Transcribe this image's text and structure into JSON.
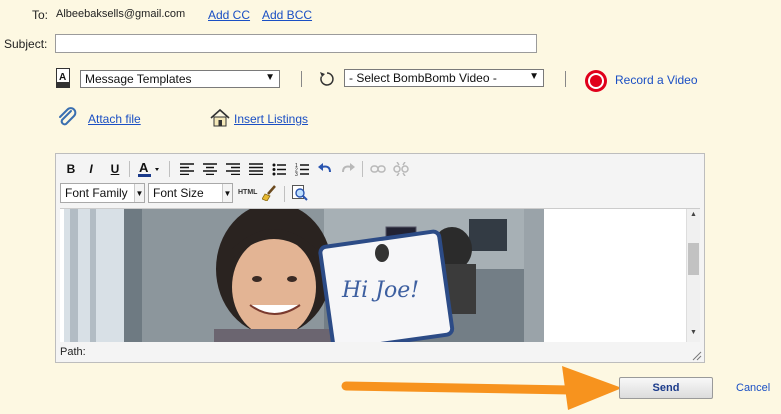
{
  "to": {
    "label": "To:",
    "email": "Albeebaksells@gmail.com",
    "add_cc": "Add CC",
    "add_bcc": "Add BCC"
  },
  "subject": {
    "label": "Subject:",
    "value": ""
  },
  "templates": {
    "selected": "Message Templates"
  },
  "bombbomb": {
    "selected": "- Select BombBomb Video -",
    "record_label": "Record a Video"
  },
  "attach": {
    "attach_file": "Attach file",
    "insert_listings": "Insert Listings"
  },
  "editor": {
    "font_family": "Font Family",
    "font_size": "Font Size",
    "html_label": "HTML",
    "path_label": "Path:",
    "whiteboard_text": "Hi Joe!"
  },
  "actions": {
    "send": "Send",
    "cancel": "Cancel"
  },
  "colors": {
    "accent_link": "#1a4fc4",
    "record_red": "#e0001b",
    "arrow_orange": "#f7931e",
    "background": "#fdf8e2"
  }
}
